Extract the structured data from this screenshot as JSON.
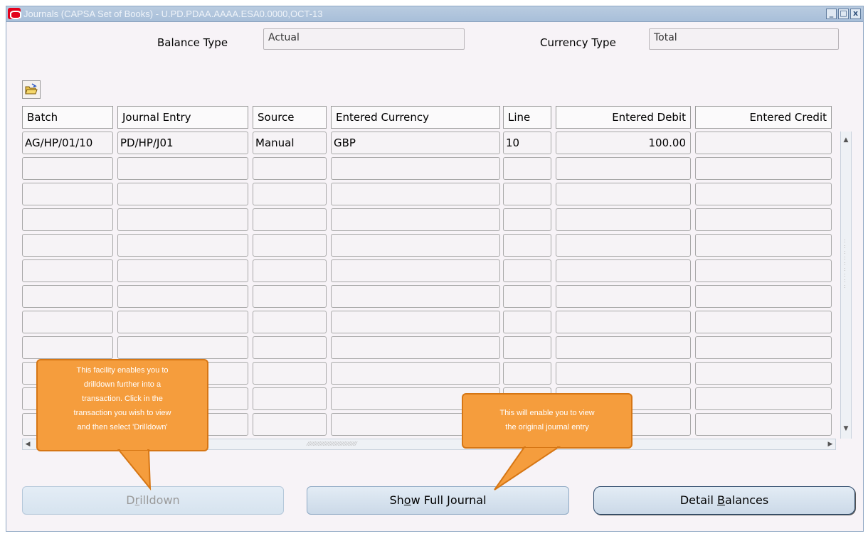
{
  "window": {
    "title": "Journals (CAPSA Set of Books) - U.PD.PDAA.AAAA.ESA0.0000,OCT-13",
    "minimize": "_",
    "maximize": "□",
    "close": "x"
  },
  "header": {
    "balance_type_label": "Balance Type",
    "balance_type_value": "Actual",
    "currency_type_label": "Currency Type",
    "currency_type_value": "Total"
  },
  "table": {
    "columns": [
      "Batch",
      "Journal Entry",
      "Source",
      "Entered Currency",
      "Line",
      "Entered Debit",
      "Entered Credit"
    ],
    "rows": [
      [
        "AG/HP/01/10",
        "PD/HP/J01",
        "Manual",
        "GBP",
        "10",
        "100.00",
        ""
      ],
      [
        "",
        "",
        "",
        "",
        "",
        "",
        ""
      ],
      [
        "",
        "",
        "",
        "",
        "",
        "",
        ""
      ],
      [
        "",
        "",
        "",
        "",
        "",
        "",
        ""
      ],
      [
        "",
        "",
        "",
        "",
        "",
        "",
        ""
      ],
      [
        "",
        "",
        "",
        "",
        "",
        "",
        ""
      ],
      [
        "",
        "",
        "",
        "",
        "",
        "",
        ""
      ],
      [
        "",
        "",
        "",
        "",
        "",
        "",
        ""
      ],
      [
        "",
        "",
        "",
        "",
        "",
        "",
        ""
      ],
      [
        "",
        "",
        "",
        "",
        "",
        "",
        ""
      ],
      [
        "",
        "",
        "",
        "",
        "",
        "",
        ""
      ],
      [
        "",
        "",
        "",
        "",
        "",
        "",
        ""
      ]
    ]
  },
  "buttons": {
    "drilldown_pre": "D",
    "drilldown_mnemonic": "r",
    "drilldown_post": "illdown",
    "show_full_pre": "Sh",
    "show_full_mnemonic": "o",
    "show_full_post": "w Full Journal",
    "detail_pre": "Detail ",
    "detail_mnemonic": "B",
    "detail_post": "alances"
  },
  "callouts": {
    "drilldown_lines": [
      "This facility enables you to",
      "drilldown further into a",
      "transaction. Click in the",
      "transaction you wish to view",
      "and then select 'Drilldown'"
    ],
    "journal_lines": [
      "This will enable you to view",
      "the original journal entry"
    ]
  },
  "colors": {
    "callout": "#f59d3d",
    "titlebar": "#a8bfd9",
    "window_bg": "#f7f3f7"
  }
}
